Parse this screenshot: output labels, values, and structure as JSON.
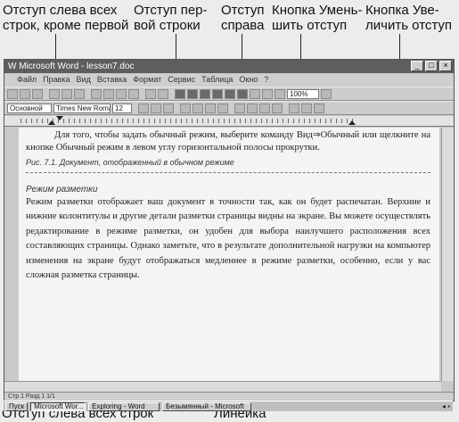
{
  "callouts": {
    "left_indent_except_first": "Отступ слева всех\nстрок, кроме первой",
    "first_line_indent": "Отступ пер-\nвой строки",
    "right_indent": "Отступ\nсправа",
    "decrease_indent_button": "Кнопка Умень-\nшить отступ",
    "increase_indent_button": "Кнопка Уве-\nличить отступ",
    "left_indent_all_lines": "Отступ слева всех строк",
    "ruler": "Линейка"
  },
  "window": {
    "title": "W Microsoft Word - lesson7.doc",
    "controls": [
      "_",
      "□",
      "×"
    ]
  },
  "menubar": {
    "items": [
      "Файл",
      "Правка",
      "Вид",
      "Вставка",
      "Формат",
      "Сервис",
      "Таблица",
      "Окно",
      "?"
    ]
  },
  "toolbar": {
    "style_value": "Основной",
    "font_value": "Times New Roman",
    "size_value": "12",
    "zoom_value": "100%"
  },
  "document": {
    "para1": "Для того, чтобы задать обычный режим, выберите команду Вид⇒Обычный или щелкните на кнопке Обычный режим в левом углу горизонтальной полосы прокрутки.",
    "caption": "Рис. 7.1. Документ, отображенный в обычном режиме",
    "heading": "Режим разметки",
    "para2": "Режим разметки отображает ваш документ в точности так, как он будет распечатан. Верхние и нижние колонтитулы и другие детали разметки страницы видны на экране. Вы можете осуществлять редактирование в режиме разметки, он удобен для выбора наилучшего расположения всех составляющих страницы. Однако заметьте, что в результате дополнительной нагрузки на компьютер изменения на экране будут отображаться медленнее в режиме разметки, особенно, если у вас сложная разметка страницы."
  },
  "statusbar": {
    "text": "Стр 1   Разд 1   1/1"
  },
  "taskbar": {
    "start": "Пуск",
    "tasks": [
      "Microsoft Wor...",
      "Exploring - Word",
      "Безымянный - Microsoft"
    ]
  },
  "colors": {
    "titlebar": "#5e5e5e",
    "window": "#c9c9c9",
    "page": "#f4f4f4"
  }
}
